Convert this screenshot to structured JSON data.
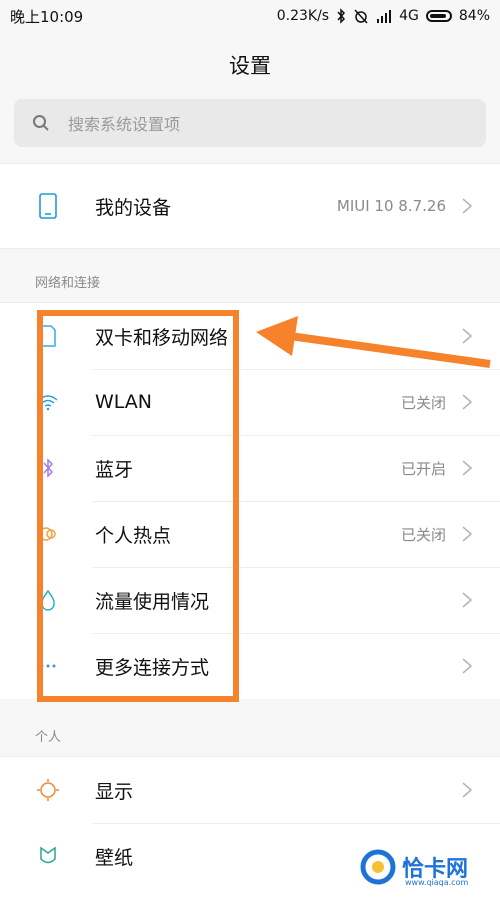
{
  "status": {
    "time": "晚上10:09",
    "net_speed": "0.23K/s",
    "network": "4G",
    "battery": "84%"
  },
  "page_title": "设置",
  "search": {
    "placeholder": "搜索系统设置项"
  },
  "device": {
    "label": "我的设备",
    "value": "MIUI 10 8.7.26"
  },
  "sections": {
    "network": "网络和连接",
    "personal": "个人"
  },
  "network_items": [
    {
      "label": "双卡和移动网络",
      "value": "",
      "icon": "sim-card-icon"
    },
    {
      "label": "WLAN",
      "value": "已关闭",
      "icon": "wifi-icon"
    },
    {
      "label": "蓝牙",
      "value": "已开启",
      "icon": "bluetooth-icon"
    },
    {
      "label": "个人热点",
      "value": "已关闭",
      "icon": "hotspot-icon"
    },
    {
      "label": "流量使用情况",
      "value": "",
      "icon": "data-usage-icon"
    },
    {
      "label": "更多连接方式",
      "value": "",
      "icon": "more-icon"
    }
  ],
  "personal_items": [
    {
      "label": "显示",
      "icon": "display-icon"
    },
    {
      "label": "壁纸",
      "icon": "wallpaper-icon"
    }
  ],
  "watermark": {
    "text": "恰卡网",
    "sub": "www.qiaqa.com"
  },
  "colors": {
    "accent": "#f6822c",
    "blue": "#1e73d9"
  }
}
